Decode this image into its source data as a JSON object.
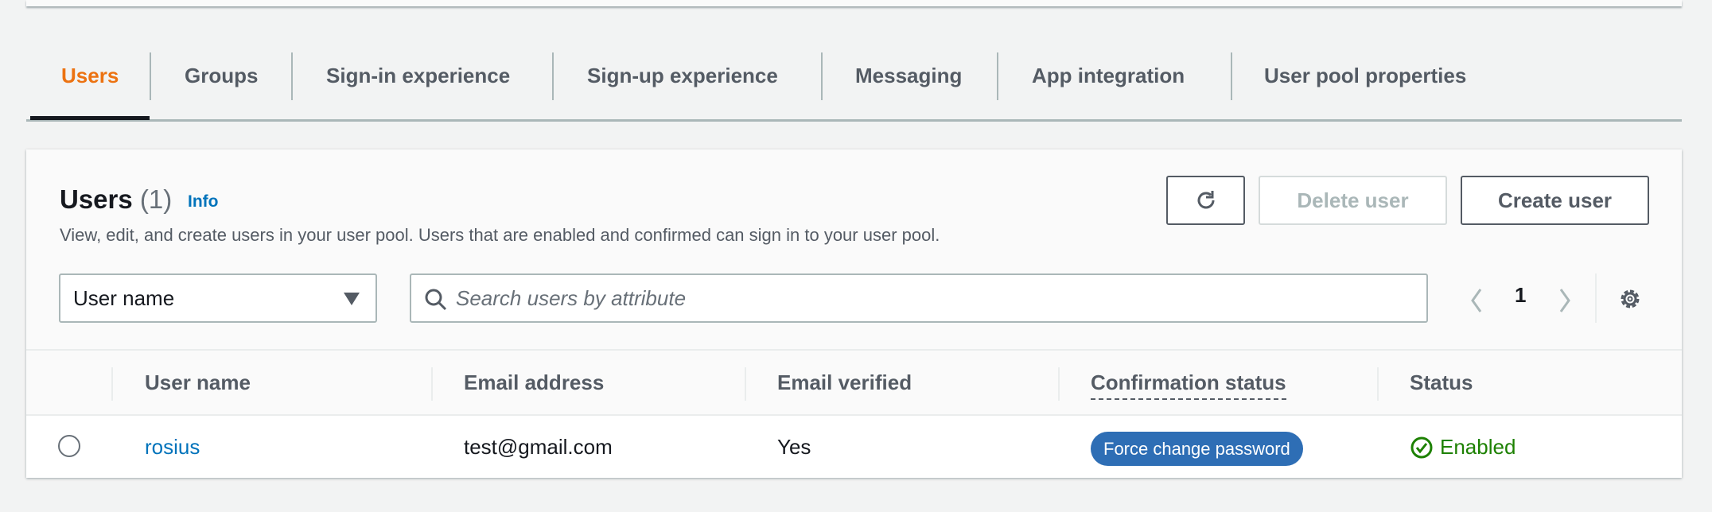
{
  "tabs": [
    {
      "label": "Users",
      "active": true
    },
    {
      "label": "Groups"
    },
    {
      "label": "Sign-in experience"
    },
    {
      "label": "Sign-up experience"
    },
    {
      "label": "Messaging"
    },
    {
      "label": "App integration"
    },
    {
      "label": "User pool properties"
    }
  ],
  "users_panel": {
    "title": "Users",
    "count": "(1)",
    "info_link": "Info",
    "description": "View, edit, and create users in your user pool. Users that are enabled and confirmed can sign in to your user pool.",
    "refresh_icon": "refresh-icon",
    "delete_label": "Delete user",
    "create_label": "Create user",
    "filter_select": "User name",
    "search_placeholder": "Search users by attribute",
    "page": "1",
    "columns": [
      "User name",
      "Email address",
      "Email verified",
      "Confirmation status",
      "Status"
    ],
    "rows": [
      {
        "user_name": "rosius",
        "email": "test@gmail.com",
        "email_verified": "Yes",
        "confirmation_status": "Force change password",
        "status": "Enabled"
      }
    ]
  },
  "colors": {
    "accent": "#ec7211",
    "link": "#0073bb",
    "badge": "#2e6eb5",
    "success": "#1d8102"
  }
}
